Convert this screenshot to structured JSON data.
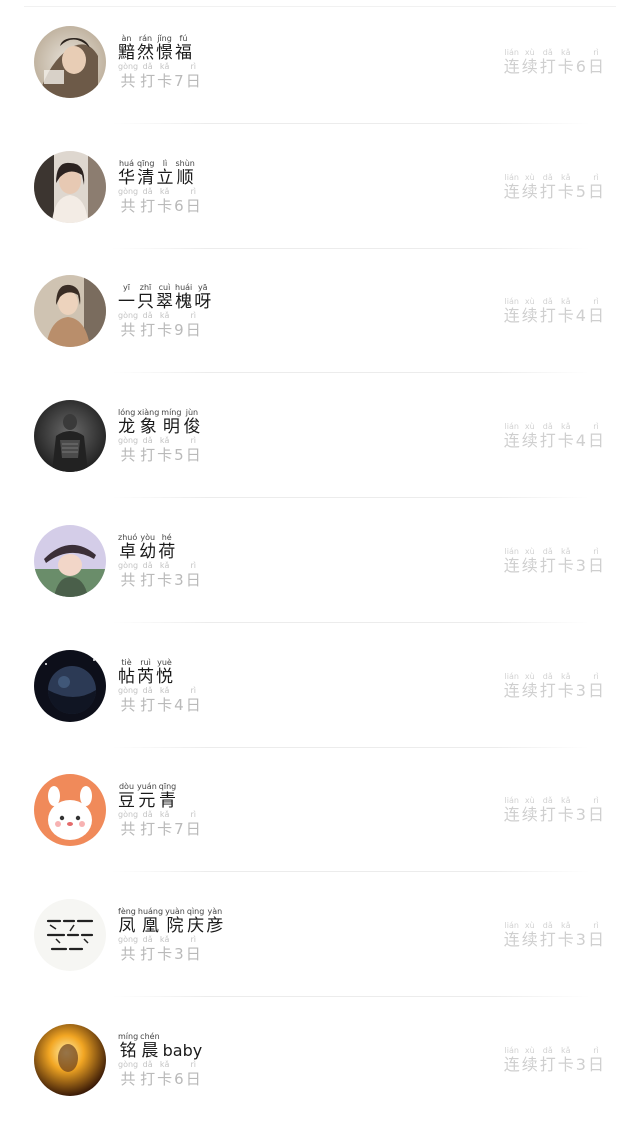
{
  "rows": [
    {
      "avatar": "girl-hair-photo-avatar",
      "name": [
        {
          "py": "àn",
          "hz": "黯"
        },
        {
          "py": "rán",
          "hz": "然"
        },
        {
          "py": "jǐng",
          "hz": "憬"
        },
        {
          "py": "fú",
          "hz": "福"
        }
      ],
      "name_latin": "",
      "total": [
        {
          "py": "gòng",
          "hz": "共"
        },
        {
          "py": "dǎ",
          "hz": "打"
        },
        {
          "py": "kǎ",
          "hz": "卡"
        },
        {
          "py": "",
          "hz": "7"
        },
        {
          "py": "rì",
          "hz": "日"
        }
      ],
      "streak": [
        {
          "py": "lián",
          "hz": "连"
        },
        {
          "py": "xù",
          "hz": "续"
        },
        {
          "py": "dǎ",
          "hz": "打"
        },
        {
          "py": "kǎ",
          "hz": "卡"
        },
        {
          "py": "",
          "hz": "6"
        },
        {
          "py": "rì",
          "hz": "日"
        }
      ]
    },
    {
      "avatar": "girl-portrait-avatar",
      "name": [
        {
          "py": "huá",
          "hz": "华"
        },
        {
          "py": "qīng",
          "hz": "清"
        },
        {
          "py": "lì",
          "hz": "立"
        },
        {
          "py": "shùn",
          "hz": "顺"
        }
      ],
      "name_latin": "",
      "total": [
        {
          "py": "gòng",
          "hz": "共"
        },
        {
          "py": "dǎ",
          "hz": "打"
        },
        {
          "py": "kǎ",
          "hz": "卡"
        },
        {
          "py": "",
          "hz": "6"
        },
        {
          "py": "rì",
          "hz": "日"
        }
      ],
      "streak": [
        {
          "py": "lián",
          "hz": "连"
        },
        {
          "py": "xù",
          "hz": "续"
        },
        {
          "py": "dǎ",
          "hz": "打"
        },
        {
          "py": "kǎ",
          "hz": "卡"
        },
        {
          "py": "",
          "hz": "5"
        },
        {
          "py": "rì",
          "hz": "日"
        }
      ]
    },
    {
      "avatar": "girl-coat-avatar",
      "name": [
        {
          "py": "yī",
          "hz": "一"
        },
        {
          "py": "zhī",
          "hz": "只"
        },
        {
          "py": "cuì",
          "hz": "翠"
        },
        {
          "py": "huái",
          "hz": "槐"
        },
        {
          "py": "yā",
          "hz": "呀"
        }
      ],
      "name_latin": "",
      "total": [
        {
          "py": "gòng",
          "hz": "共"
        },
        {
          "py": "dǎ",
          "hz": "打"
        },
        {
          "py": "kǎ",
          "hz": "卡"
        },
        {
          "py": "",
          "hz": "9"
        },
        {
          "py": "rì",
          "hz": "日"
        }
      ],
      "streak": [
        {
          "py": "lián",
          "hz": "连"
        },
        {
          "py": "xù",
          "hz": "续"
        },
        {
          "py": "dǎ",
          "hz": "打"
        },
        {
          "py": "kǎ",
          "hz": "卡"
        },
        {
          "py": "",
          "hz": "4"
        },
        {
          "py": "rì",
          "hz": "日"
        }
      ]
    },
    {
      "avatar": "dark-figure-avatar",
      "name": [
        {
          "py": "lóng",
          "hz": "龙"
        },
        {
          "py": "xiàng",
          "hz": "象"
        },
        {
          "py": "míng",
          "hz": "明"
        },
        {
          "py": "jùn",
          "hz": "俊"
        }
      ],
      "name_latin": "",
      "total": [
        {
          "py": "gòng",
          "hz": "共"
        },
        {
          "py": "dǎ",
          "hz": "打"
        },
        {
          "py": "kǎ",
          "hz": "卡"
        },
        {
          "py": "",
          "hz": "5"
        },
        {
          "py": "rì",
          "hz": "日"
        }
      ],
      "streak": [
        {
          "py": "lián",
          "hz": "连"
        },
        {
          "py": "xù",
          "hz": "续"
        },
        {
          "py": "dǎ",
          "hz": "打"
        },
        {
          "py": "kǎ",
          "hz": "卡"
        },
        {
          "py": "",
          "hz": "4"
        },
        {
          "py": "rì",
          "hz": "日"
        }
      ]
    },
    {
      "avatar": "girl-hat-anime-avatar",
      "name": [
        {
          "py": "zhuó",
          "hz": "卓"
        },
        {
          "py": "yòu",
          "hz": "幼"
        },
        {
          "py": "hé",
          "hz": "荷"
        }
      ],
      "name_latin": "",
      "total": [
        {
          "py": "gòng",
          "hz": "共"
        },
        {
          "py": "dǎ",
          "hz": "打"
        },
        {
          "py": "kǎ",
          "hz": "卡"
        },
        {
          "py": "",
          "hz": "3"
        },
        {
          "py": "rì",
          "hz": "日"
        }
      ],
      "streak": [
        {
          "py": "lián",
          "hz": "连"
        },
        {
          "py": "xù",
          "hz": "续"
        },
        {
          "py": "dǎ",
          "hz": "打"
        },
        {
          "py": "kǎ",
          "hz": "卡"
        },
        {
          "py": "",
          "hz": "3"
        },
        {
          "py": "rì",
          "hz": "日"
        }
      ]
    },
    {
      "avatar": "planet-avatar",
      "name": [
        {
          "py": "tiè",
          "hz": "帖"
        },
        {
          "py": "ruì",
          "hz": "芮"
        },
        {
          "py": "yuè",
          "hz": "悦"
        }
      ],
      "name_latin": "",
      "total": [
        {
          "py": "gòng",
          "hz": "共"
        },
        {
          "py": "dǎ",
          "hz": "打"
        },
        {
          "py": "kǎ",
          "hz": "卡"
        },
        {
          "py": "",
          "hz": "4"
        },
        {
          "py": "rì",
          "hz": "日"
        }
      ],
      "streak": [
        {
          "py": "lián",
          "hz": "连"
        },
        {
          "py": "xù",
          "hz": "续"
        },
        {
          "py": "dǎ",
          "hz": "打"
        },
        {
          "py": "kǎ",
          "hz": "卡"
        },
        {
          "py": "",
          "hz": "3"
        },
        {
          "py": "rì",
          "hz": "日"
        }
      ]
    },
    {
      "avatar": "cartoon-bunny-avatar",
      "name": [
        {
          "py": "dòu",
          "hz": "豆"
        },
        {
          "py": "yuán",
          "hz": "元"
        },
        {
          "py": "qīng",
          "hz": "青"
        }
      ],
      "name_latin": "",
      "total": [
        {
          "py": "gòng",
          "hz": "共"
        },
        {
          "py": "dǎ",
          "hz": "打"
        },
        {
          "py": "kǎ",
          "hz": "卡"
        },
        {
          "py": "",
          "hz": "7"
        },
        {
          "py": "rì",
          "hz": "日"
        }
      ],
      "streak": [
        {
          "py": "lián",
          "hz": "连"
        },
        {
          "py": "xù",
          "hz": "续"
        },
        {
          "py": "dǎ",
          "hz": "打"
        },
        {
          "py": "kǎ",
          "hz": "卡"
        },
        {
          "py": "",
          "hz": "3"
        },
        {
          "py": "rì",
          "hz": "日"
        }
      ]
    },
    {
      "avatar": "handwriting-text-avatar",
      "name": [
        {
          "py": "fèng",
          "hz": "凤"
        },
        {
          "py": "huáng",
          "hz": "凰"
        },
        {
          "py": "yuàn",
          "hz": "院"
        },
        {
          "py": "qìng",
          "hz": "庆"
        },
        {
          "py": "yàn",
          "hz": "彦"
        }
      ],
      "name_latin": "",
      "total": [
        {
          "py": "gòng",
          "hz": "共"
        },
        {
          "py": "dǎ",
          "hz": "打"
        },
        {
          "py": "kǎ",
          "hz": "卡"
        },
        {
          "py": "",
          "hz": "3"
        },
        {
          "py": "rì",
          "hz": "日"
        }
      ],
      "streak": [
        {
          "py": "lián",
          "hz": "连"
        },
        {
          "py": "xù",
          "hz": "续"
        },
        {
          "py": "dǎ",
          "hz": "打"
        },
        {
          "py": "kǎ",
          "hz": "卡"
        },
        {
          "py": "",
          "hz": "3"
        },
        {
          "py": "rì",
          "hz": "日"
        }
      ]
    },
    {
      "avatar": "fire-glow-avatar",
      "name": [
        {
          "py": "míng",
          "hz": "铭"
        },
        {
          "py": "chén",
          "hz": "晨"
        }
      ],
      "name_latin": "baby",
      "total": [
        {
          "py": "gòng",
          "hz": "共"
        },
        {
          "py": "dǎ",
          "hz": "打"
        },
        {
          "py": "kǎ",
          "hz": "卡"
        },
        {
          "py": "",
          "hz": "6"
        },
        {
          "py": "rì",
          "hz": "日"
        }
      ],
      "streak": [
        {
          "py": "lián",
          "hz": "连"
        },
        {
          "py": "xù",
          "hz": "续"
        },
        {
          "py": "dǎ",
          "hz": "打"
        },
        {
          "py": "kǎ",
          "hz": "卡"
        },
        {
          "py": "",
          "hz": "3"
        },
        {
          "py": "rì",
          "hz": "日"
        }
      ]
    }
  ]
}
